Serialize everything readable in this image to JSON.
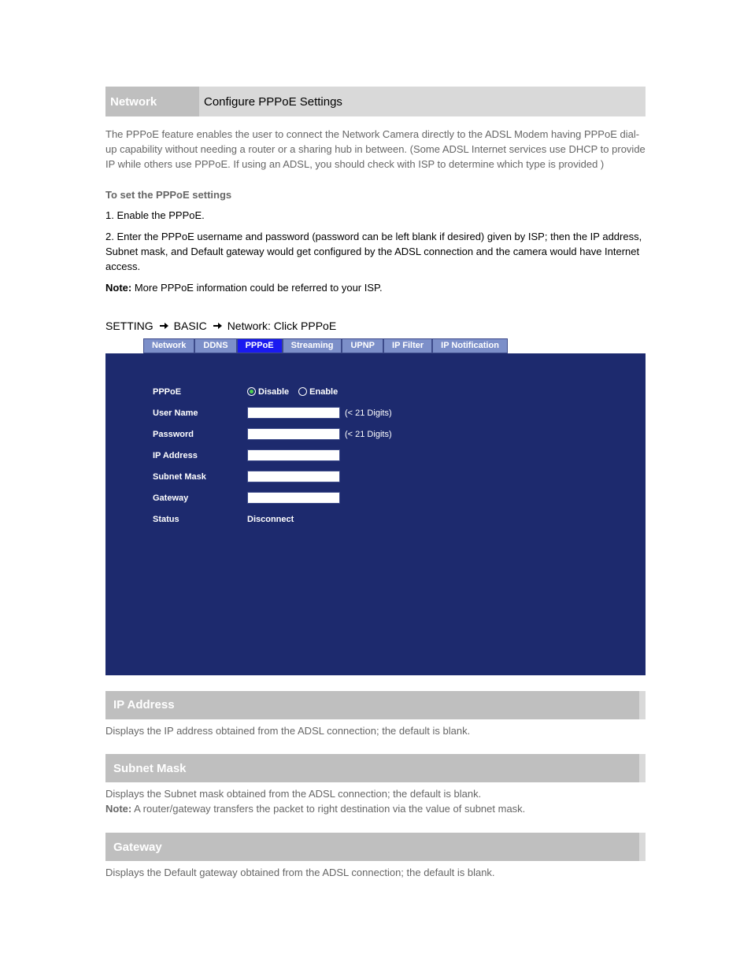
{
  "header": {
    "category": "Network",
    "title": "Configure PPPoE Settings"
  },
  "intro": "The PPPoE feature enables the user to connect the Network Camera directly to the ADSL Modem having PPPoE dial-up capability without needing a router or a sharing hub in between. (Some ADSL Internet services use DHCP to provide IP while others use PPPoE. If using an ADSL, you should check with ISP to determine which type is provided )",
  "subtitle": "To set the PPPoE settings",
  "steps": [
    "1. Enable the PPPoE.",
    "2. Enter the PPPoE username and password (password can be left blank if desired) given by ISP; then the IP address, Subnet mask, and Default gateway would get configured by the ADSL connection and the camera would have Internet access."
  ],
  "note_label": "Note:",
  "note_body": " More PPPoE information could be referred to your ISP.",
  "path": {
    "root": "SETTING",
    "mid": "BASIC",
    "leaf": "Network: Click PPPoE"
  },
  "tabs": [
    "Network",
    "DDNS",
    "PPPoE",
    "Streaming",
    "UPNP",
    "IP Filter",
    "IP Notification"
  ],
  "active_tab_index": 2,
  "form": {
    "pppoe_label": "PPPoE",
    "disable_label": "Disable",
    "enable_label": "Enable",
    "user_name": {
      "label": "User Name",
      "hint": "(< 21 Digits)",
      "value": ""
    },
    "password": {
      "label": "Password",
      "hint": "(< 21 Digits)",
      "value": ""
    },
    "ip": {
      "label": "IP Address",
      "value": ""
    },
    "mask": {
      "label": "Subnet Mask",
      "value": ""
    },
    "gw": {
      "label": "Gateway",
      "value": ""
    },
    "status_label": "Status",
    "status_value": "Disconnect"
  },
  "sections": {
    "ip": {
      "title": "IP Address",
      "body": "Displays the IP address obtained from the ADSL connection; the default is blank."
    },
    "mask": {
      "title": "Subnet Mask",
      "body_line1": "Displays the Subnet mask obtained from the ADSL connection; the default is blank.",
      "note_label": "Note:",
      "note_body": " A router/gateway transfers the packet to right destination via the value of subnet mask."
    },
    "gw": {
      "title": "Gateway",
      "body": "Displays the Default gateway obtained from the ADSL connection; the default is blank."
    }
  }
}
